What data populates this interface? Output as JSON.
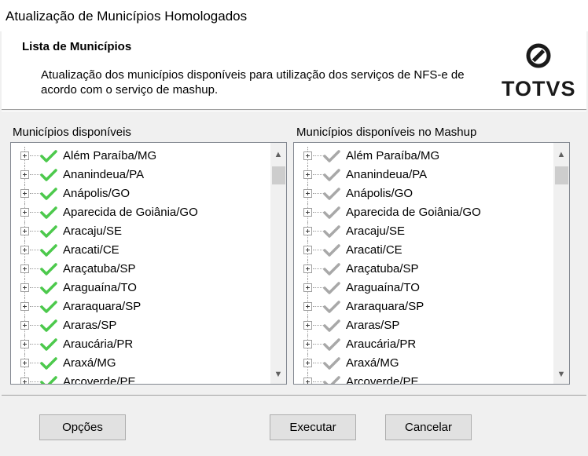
{
  "window": {
    "title": "Atualização de Municípios Homologados"
  },
  "header": {
    "title": "Lista de Municípios",
    "description": "Atualização dos  municípios disponíveis para utilização dos serviços de NFS-e de acordo com o serviço de mashup.",
    "logo_text": "TOTVS",
    "logo_icon": "totvs-logo-icon"
  },
  "left_panel": {
    "label": "Municípios disponíveis",
    "check_color": "#4cc94c",
    "items": [
      "Além Paraíba/MG",
      "Ananindeua/PA",
      "Anápolis/GO",
      "Aparecida de Goiânia/GO",
      "Aracaju/SE",
      "Aracati/CE",
      "Araçatuba/SP",
      "Araguaína/TO",
      "Araraquara/SP",
      "Araras/SP",
      "Araucária/PR",
      "Araxá/MG",
      "Arcoverde/PE"
    ]
  },
  "right_panel": {
    "label": "Municípios disponíveis no Mashup",
    "check_color": "#a8a8a8",
    "items": [
      "Além Paraíba/MG",
      "Ananindeua/PA",
      "Anápolis/GO",
      "Aparecida de Goiânia/GO",
      "Aracaju/SE",
      "Aracati/CE",
      "Araçatuba/SP",
      "Araguaína/TO",
      "Araraquara/SP",
      "Araras/SP",
      "Araucária/PR",
      "Araxá/MG",
      "Arcoverde/PE"
    ]
  },
  "buttons": {
    "options": "Opções",
    "execute": "Executar",
    "cancel": "Cancelar"
  }
}
